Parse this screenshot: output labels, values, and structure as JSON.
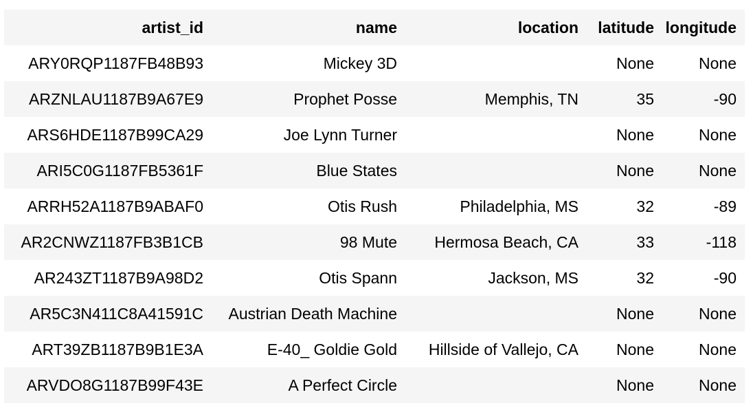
{
  "table": {
    "columns": [
      "artist_id",
      "name",
      "location",
      "latitude",
      "longitude"
    ],
    "rows": [
      [
        "ARY0RQP1187FB48B93",
        "Mickey 3D",
        "",
        "None",
        "None"
      ],
      [
        "ARZNLAU1187B9A67E9",
        "Prophet Posse",
        "Memphis, TN",
        "35",
        "-90"
      ],
      [
        "ARS6HDE1187B99CA29",
        "Joe Lynn Turner",
        "",
        "None",
        "None"
      ],
      [
        "ARI5C0G1187FB5361F",
        "Blue States",
        "",
        "None",
        "None"
      ],
      [
        "ARRH52A1187B9ABAF0",
        "Otis Rush",
        "Philadelphia, MS",
        "32",
        "-89"
      ],
      [
        "AR2CNWZ1187FB3B1CB",
        "98 Mute",
        "Hermosa Beach, CA",
        "33",
        "-118"
      ],
      [
        "AR243ZT1187B9A98D2",
        "Otis Spann",
        "Jackson, MS",
        "32",
        "-90"
      ],
      [
        "AR5C3N411C8A41591C",
        "Austrian Death Machine",
        "",
        "None",
        "None"
      ],
      [
        "ART39ZB1187B9B1E3A",
        "E-40_ Goldie Gold",
        "Hillside of Vallejo, CA",
        "None",
        "None"
      ],
      [
        "ARVDO8G1187B99F43E",
        "A Perfect Circle",
        "",
        "None",
        "None"
      ]
    ]
  }
}
